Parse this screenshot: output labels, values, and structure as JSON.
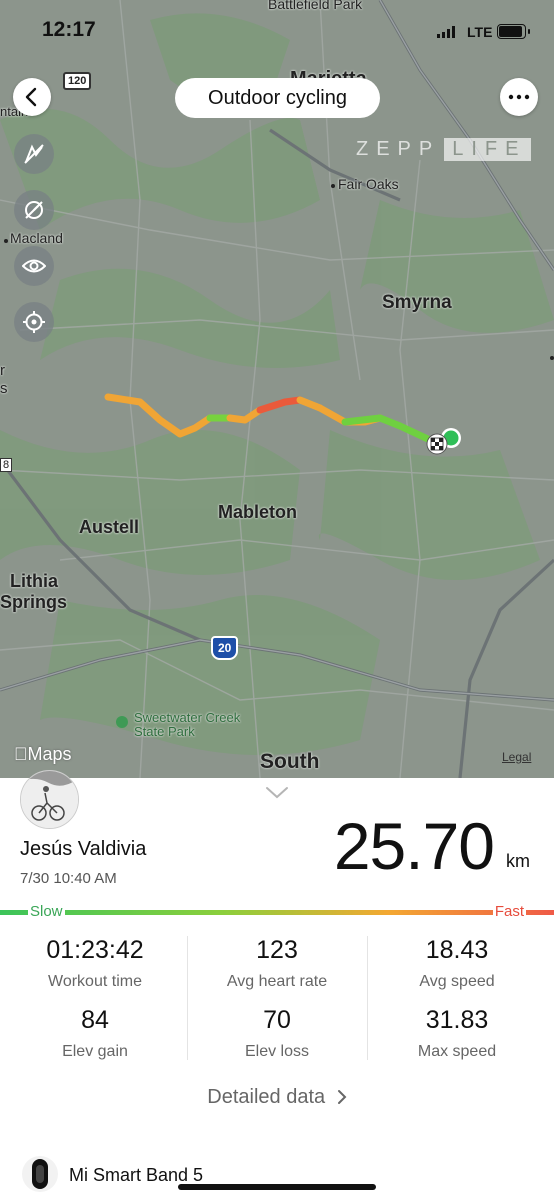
{
  "status_bar": {
    "time": "12:17",
    "network": "LTE"
  },
  "header": {
    "title": "Outdoor cycling",
    "back_icon": "chevron-left-icon",
    "more_icon": "more-dots-icon",
    "brand": "ZEPP LIFE"
  },
  "map": {
    "labels": {
      "battlefield_park": "Battlefield Park",
      "marietta": "Marietta",
      "fair_oaks": "Fair Oaks",
      "macland": "Macland",
      "smyrna": "Smyrna",
      "austell": "Austell",
      "mableton": "Mableton",
      "lithia": "Lithia",
      "springs": "Springs",
      "sweetwater_1": "Sweetwater Creek",
      "sweetwater_2": "State Park",
      "south": "South",
      "highway_120": "120",
      "highway_20": "20",
      "apple_maps": "Maps",
      "legal": "Legal",
      "edge_left_1": "ntain",
      "edge_left_2": "r",
      "edge_left_3": "s",
      "edge_left_4": "8"
    },
    "tools": [
      "route-hide-icon",
      "speed-off-icon",
      "eye-icon",
      "locate-icon"
    ]
  },
  "summary": {
    "user_name": "Jesús Valdivia",
    "date": "7/30 10:40 AM",
    "distance": "25.70",
    "distance_unit": "km",
    "pace_legend": {
      "slow": "Slow",
      "fast": "Fast"
    },
    "stats": [
      {
        "value": "01:23:42",
        "label": "Workout time"
      },
      {
        "value": "123",
        "label": "Avg heart rate"
      },
      {
        "value": "18.43",
        "label": "Avg speed"
      },
      {
        "value": "84",
        "label": "Elev gain"
      },
      {
        "value": "70",
        "label": "Elev loss"
      },
      {
        "value": "31.83",
        "label": "Max speed"
      }
    ],
    "detailed_link": "Detailed data",
    "device_name": "Mi Smart Band 5"
  }
}
